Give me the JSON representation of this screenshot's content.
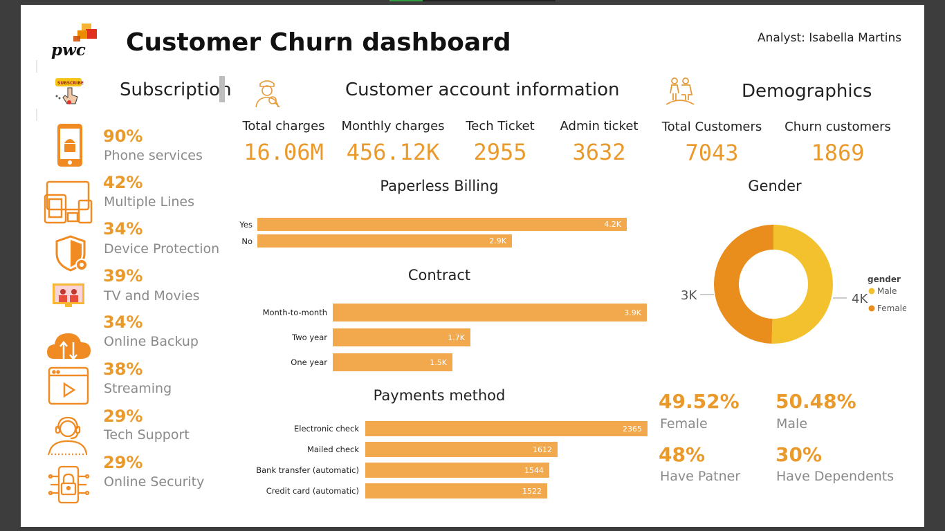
{
  "header": {
    "logo_text": "pwc",
    "title": "Customer Churn dashboard",
    "analyst": "Analyst: Isabella Martins"
  },
  "sections": {
    "subscription": "Subscription",
    "account": "Customer account information",
    "demographics": "Demographics"
  },
  "subscription_items": [
    {
      "pct": "90%",
      "label": "Phone services",
      "icon": "phone-icon"
    },
    {
      "pct": "42%",
      "label": "Multiple Lines",
      "icon": "devices-icon"
    },
    {
      "pct": "34%",
      "label": "Device Protection",
      "icon": "shield-icon"
    },
    {
      "pct": "39%",
      "label": "TV and Movies",
      "icon": "tv-icon"
    },
    {
      "pct": "34%",
      "label": "Online Backup",
      "icon": "cloud-icon"
    },
    {
      "pct": "38%",
      "label": "Streaming",
      "icon": "play-icon"
    },
    {
      "pct": "29%",
      "label": "Tech Support",
      "icon": "headset-icon"
    },
    {
      "pct": "29%",
      "label": "Online Security",
      "icon": "lock-icon"
    }
  ],
  "kpis": [
    {
      "label": "Total charges",
      "value": "16.06M"
    },
    {
      "label": "Monthly charges",
      "value": "456.12K"
    },
    {
      "label": "Tech Ticket",
      "value": "2955"
    },
    {
      "label": "Admin ticket",
      "value": "3632"
    },
    {
      "label": "Total Customers",
      "value": "7043"
    },
    {
      "label": "Churn customers",
      "value": "1869"
    }
  ],
  "demographics": [
    {
      "pct": "49.52%",
      "label": "Female"
    },
    {
      "pct": "50.48%",
      "label": "Male"
    },
    {
      "pct": "48%",
      "label": "Have Patner"
    },
    {
      "pct": "30%",
      "label": "Have Dependents"
    }
  ],
  "colors": {
    "accent": "#ea9a2b",
    "bar": "#f2a94d",
    "male": "#f4c12e",
    "female": "#e98e1d"
  },
  "chart_data": [
    {
      "type": "bar",
      "title": "Paperless Billing",
      "orientation": "horizontal",
      "categories": [
        "Yes",
        "No"
      ],
      "values": [
        4171,
        2872
      ],
      "value_labels": [
        "4.2K",
        "2.9K"
      ]
    },
    {
      "type": "bar",
      "title": "Contract",
      "orientation": "horizontal",
      "categories": [
        "Month-to-month",
        "Two year",
        "One year"
      ],
      "values": [
        3875,
        1695,
        1473
      ],
      "value_labels": [
        "3.9K",
        "1.7K",
        "1.5K"
      ]
    },
    {
      "type": "bar",
      "title": "Payments method",
      "orientation": "horizontal",
      "categories": [
        "Electronic check",
        "Mailed check",
        "Bank transfer (automatic)",
        "Credit card (automatic)"
      ],
      "values": [
        2365,
        1612,
        1544,
        1522
      ],
      "value_labels": [
        "2365",
        "1612",
        "1544",
        "1522"
      ]
    },
    {
      "type": "pie",
      "title": "Gender",
      "donut": true,
      "legend_title": "gender",
      "legend_position": "right",
      "series": [
        {
          "name": "Male",
          "value": 3555,
          "label": "4K"
        },
        {
          "name": "Female",
          "value": 3488,
          "label": "3K"
        }
      ]
    }
  ]
}
